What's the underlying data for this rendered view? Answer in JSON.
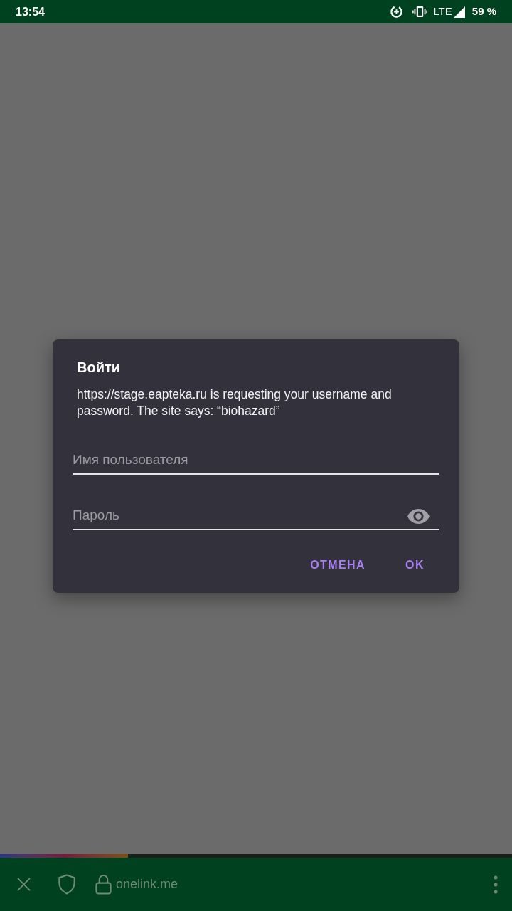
{
  "status_bar": {
    "time": "13:54",
    "network": "LTE",
    "battery": "59 %"
  },
  "dialog": {
    "title": "Войти",
    "message": "https://stage.eapteka.ru is requesting your username and password. The site says: “biohazard”",
    "fields": [
      {
        "kind": "text",
        "placeholder": "Имя пользователя"
      },
      {
        "kind": "password",
        "placeholder": "Пароль"
      }
    ],
    "buttons": [
      "ОТМЕНА",
      "OK"
    ]
  },
  "page_progress": {
    "level": 0.25
  },
  "toolbar": {
    "url": "onelink.me"
  }
}
